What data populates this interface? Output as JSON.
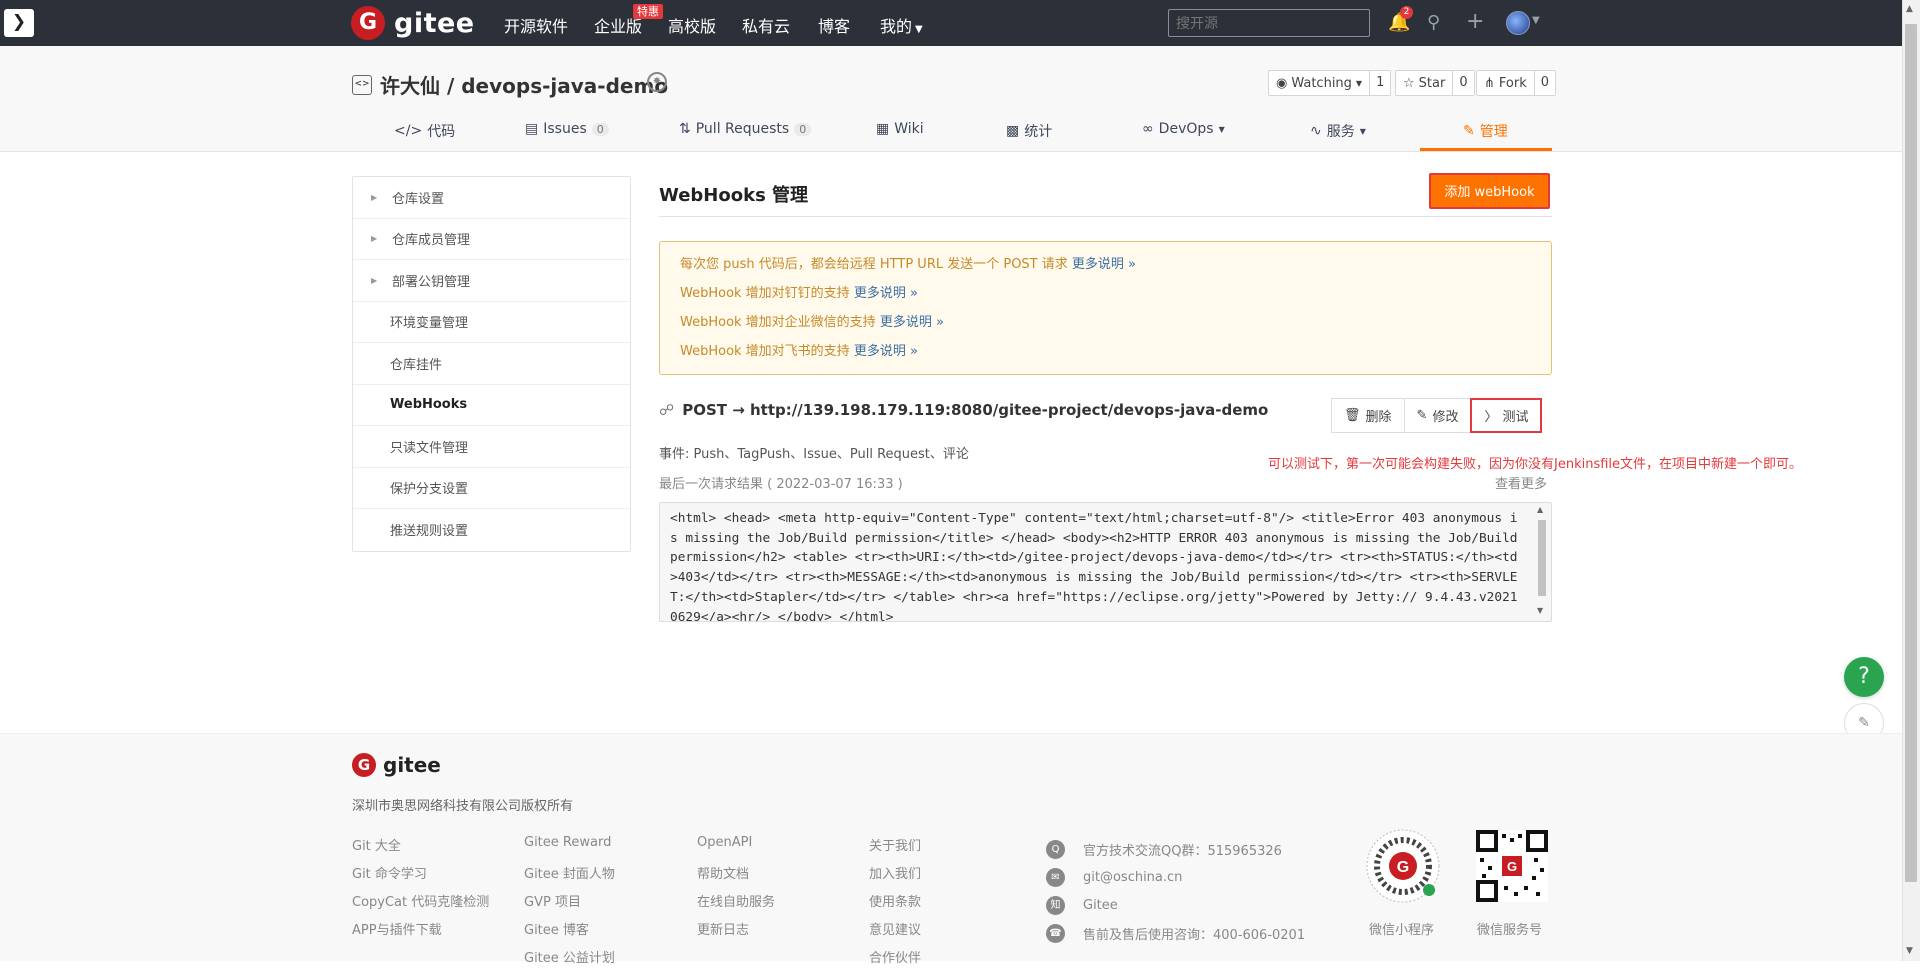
{
  "topbar": {
    "logo_letter": "G",
    "logo_text": "gitee",
    "nav": [
      "开源软件",
      "企业版",
      "高校版",
      "私有云",
      "博客",
      "我的"
    ],
    "hot_badge": "特惠",
    "search_placeholder": "搜开源",
    "notifications": "2"
  },
  "repo": {
    "title": "许大仙 / devops-java-demo",
    "watching_label": "Watching",
    "watching_count": "1",
    "star_label": "Star",
    "star_count": "0",
    "fork_label": "Fork",
    "fork_count": "0"
  },
  "tabs": [
    {
      "label": "代码"
    },
    {
      "label": "Issues",
      "count": "0"
    },
    {
      "label": "Pull Requests",
      "count": "0"
    },
    {
      "label": "Wiki"
    },
    {
      "label": "统计"
    },
    {
      "label": "DevOps"
    },
    {
      "label": "服务"
    },
    {
      "label": "管理"
    }
  ],
  "sidebar": {
    "items": [
      "仓库设置",
      "仓库成员管理",
      "部署公钥管理",
      "环境变量管理",
      "仓库挂件",
      "WebHooks",
      "只读文件管理",
      "保护分支设置",
      "推送规则设置"
    ],
    "active": "WebHooks"
  },
  "main": {
    "title": "WebHooks 管理",
    "add_button": "添加 webHook",
    "notices": [
      {
        "text": "每次您 push 代码后，都会给远程 HTTP URL 发送一个 POST 请求",
        "link": "更多说明 »"
      },
      {
        "text": "WebHook 增加对钉钉的支持",
        "link": "更多说明 »"
      },
      {
        "text": "WebHook 增加对企业微信的支持",
        "link": "更多说明 »"
      },
      {
        "text": "WebHook 增加对飞书的支持",
        "link": "更多说明 »"
      }
    ],
    "hook_url": "POST → http://139.198.179.119:8080/gitee-project/devops-java-demo",
    "delete_label": "删除",
    "edit_label": "修改",
    "test_label": "测试",
    "annotation": "可以测试下，第一次可能会构建失败，因为你没有Jenkinsfile文件，在项目中新建一个即可。",
    "events": "事件:   Push、TagPush、Issue、Pull Request、评论",
    "last_request": "最后一次请求结果 ( 2022-03-07 16:33 )",
    "see_more": "查看更多",
    "response": "<html> <head> <meta http-equiv=\"Content-Type\" content=\"text/html;charset=utf-8\"/> <title>Error 403 anonymous is missing the Job/Build permission</title> </head> <body><h2>HTTP ERROR 403 anonymous is missing the Job/Build permission</h2> <table> <tr><th>URI:</th><td>/gitee-project/devops-java-demo</td></tr> <tr><th>STATUS:</th><td>403</td></tr> <tr><th>MESSAGE:</th><td>anonymous is missing the Job/Build permission</td></tr> <tr><th>SERVLET:</th><td>Stapler</td></tr> </table> <hr><a href=\"https://eclipse.org/jetty\">Powered by Jetty:// 9.4.43.v20210629</a><hr/> </body> </html>"
  },
  "footer": {
    "logo_text": "gitee",
    "company": "深圳市奥思网络科技有限公司版权所有",
    "col1": [
      "Git 大全",
      "Git 命令学习",
      "CopyCat 代码克隆检测",
      "APP与插件下载"
    ],
    "col2": [
      "Gitee Reward",
      "Gitee 封面人物",
      "GVP 项目",
      "Gitee 博客",
      "Gitee 公益计划"
    ],
    "col3": [
      "OpenAPI",
      "帮助文档",
      "在线自助服务",
      "更新日志"
    ],
    "col4": [
      "关于我们",
      "加入我们",
      "使用条款",
      "意见建议",
      "合作伙伴"
    ],
    "contacts": [
      {
        "icon": "qq-icon",
        "glyph": "Q",
        "text": "官方技术交流QQ群：515965326"
      },
      {
        "icon": "mail-icon",
        "glyph": "✉",
        "text": "git@oschina.cn"
      },
      {
        "icon": "zhihu-icon",
        "glyph": "知",
        "text": "Gitee"
      },
      {
        "icon": "phone-icon",
        "glyph": "☎",
        "text": "售前及售后使用咨询：400-606-0201"
      }
    ],
    "qr1_label": "微信小程序",
    "qr2_label": "微信服务号"
  },
  "colors": {
    "accent": "#fe7300",
    "brand": "#c71d23",
    "topbar": "#2c3038",
    "help": "#2aa44f"
  }
}
